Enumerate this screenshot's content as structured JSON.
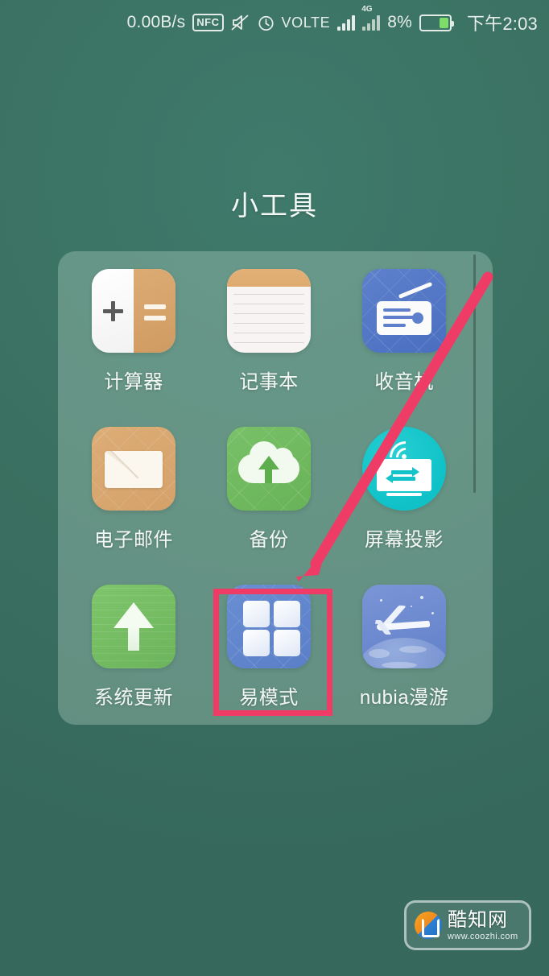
{
  "status_bar": {
    "network_speed": "0.00B/s",
    "nfc_label": "NFC",
    "mute_icon": "mute-icon",
    "alarm_icon": "alarm-icon",
    "volte_label": "VOLTE",
    "signal_icon": "signal-bars-icon",
    "data_network_label": "4G",
    "battery_percent": "8%",
    "battery_icon": "battery-icon",
    "clock": "下午2:03"
  },
  "header": {
    "title": "小工具"
  },
  "folder": {
    "scrollbar_name": "folder-scrollbar",
    "apps": [
      {
        "label": "计算器",
        "icon": "calculator-icon"
      },
      {
        "label": "记事本",
        "icon": "notepad-icon"
      },
      {
        "label": "收音机",
        "icon": "radio-icon"
      },
      {
        "label": "电子邮件",
        "icon": "email-icon"
      },
      {
        "label": "备份",
        "icon": "cloud-backup-icon"
      },
      {
        "label": "屏幕投影",
        "icon": "screen-cast-icon"
      },
      {
        "label": "系统更新",
        "icon": "system-update-icon"
      },
      {
        "label": "易模式",
        "icon": "easy-mode-icon"
      },
      {
        "label": "nubia漫游",
        "icon": "nubia-roaming-icon"
      }
    ]
  },
  "annotations": {
    "highlight_color": "#ef3c66",
    "arrow_color": "#ef3c66",
    "highlight_target": "易模式"
  },
  "watermark": {
    "site_name": "酷知网",
    "url": "www.coozhi.com"
  },
  "colors": {
    "wallpaper": "#3d7265",
    "panel": "rgba(203,228,215,0.30)",
    "accent": "#ef3c66",
    "battery_fill": "#7ddc6a"
  }
}
